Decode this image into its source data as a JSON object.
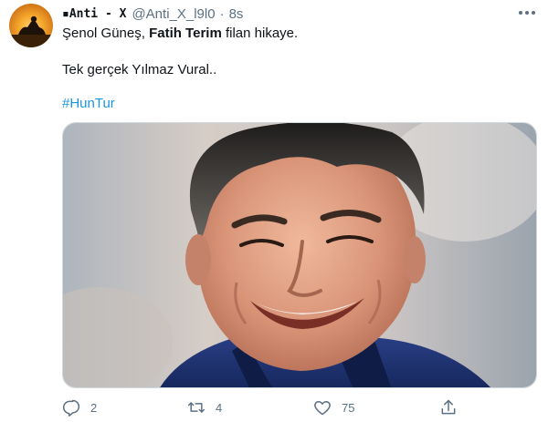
{
  "tweet": {
    "author": {
      "display_name": "▪Anti - X",
      "handle": "@Anti_X_l9l0",
      "avatar_icon": "avatar-silhouette-sunset"
    },
    "separator": "·",
    "timestamp": "8s",
    "more_icon": "more-dots-icon",
    "text": {
      "line1_pre": "Şenol Güneş, ",
      "line1_bold": "Fatih Terim",
      "line1_post": " filan hikaye.",
      "line2": "Tek gerçek Yılmaz Vural..",
      "hashtag": "#HunTur"
    },
    "media": {
      "kind": "photo",
      "subject": "smiling-man-portrait"
    },
    "actions": {
      "reply": {
        "icon": "reply-icon",
        "count": "2"
      },
      "retweet": {
        "icon": "retweet-icon",
        "count": "4"
      },
      "like": {
        "icon": "heart-icon",
        "count": "75"
      },
      "share": {
        "icon": "share-icon"
      }
    }
  },
  "colors": {
    "text_primary": "#0f1419",
    "text_secondary": "#5b7083",
    "link": "#1b95e0",
    "border": "#cfd9de",
    "jacket": "#1f3270"
  }
}
